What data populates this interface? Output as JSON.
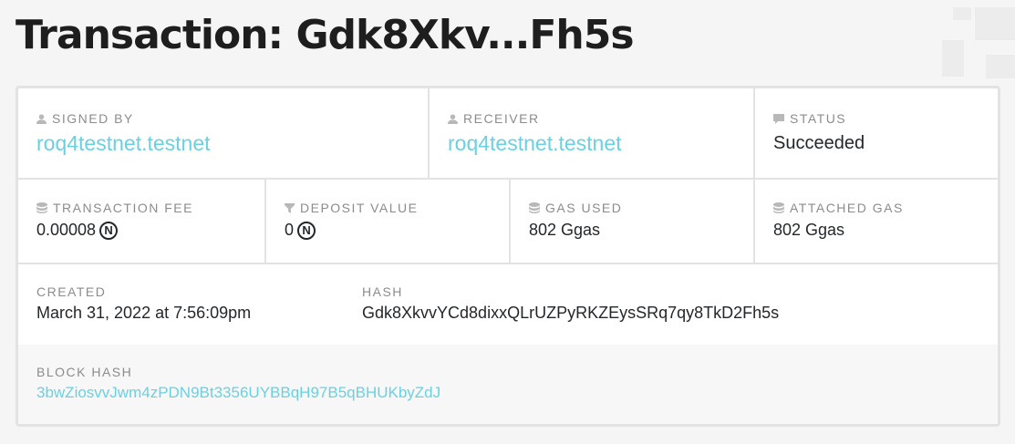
{
  "title": "Transaction: Gdk8Xkv...Fh5s",
  "signed_by": {
    "label": "SIGNED BY",
    "value": "roq4testnet.testnet",
    "icon": "user-icon"
  },
  "receiver": {
    "label": "RECEIVER",
    "value": "roq4testnet.testnet",
    "icon": "user-icon"
  },
  "status": {
    "label": "STATUS",
    "value": "Succeeded",
    "icon": "comment-icon"
  },
  "fee": {
    "label": "TRANSACTION FEE",
    "value": "0.00008",
    "unit": "N",
    "icon": "database-icon"
  },
  "deposit": {
    "label": "DEPOSIT VALUE",
    "value": "0",
    "unit": "N",
    "icon": "filter-icon"
  },
  "gas_used": {
    "label": "GAS USED",
    "value": "802 Ggas",
    "icon": "database-icon"
  },
  "attached_gas": {
    "label": "ATTACHED GAS",
    "value": "802 Ggas",
    "icon": "database-icon"
  },
  "created": {
    "label": "CREATED",
    "value": "March 31, 2022 at 7:56:09pm"
  },
  "hash": {
    "label": "HASH",
    "value": "Gdk8XkvvYCd8dixxQLrUZPyRKZEysSRq7qy8TkD2Fh5s"
  },
  "block_hash": {
    "label": "BLOCK HASH",
    "value": "3bwZiosvvJwm4zPDN9Bt3356UYBBqH97B5qBHUKbyZdJ"
  }
}
